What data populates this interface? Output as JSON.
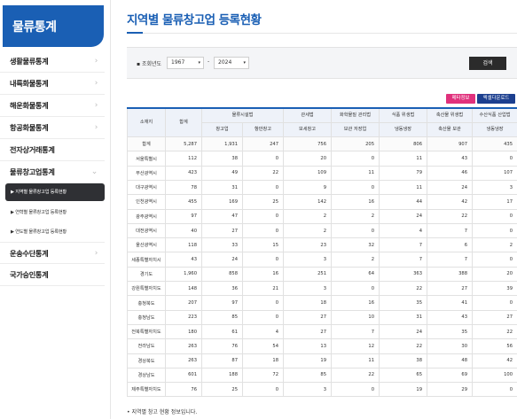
{
  "sidebar": {
    "title": "물류통계",
    "items": [
      {
        "label": "생활물류통계",
        "chev": "›"
      },
      {
        "label": "내륙화물통계",
        "chev": "›"
      },
      {
        "label": "해운화물통계",
        "chev": "›"
      },
      {
        "label": "항공화물통계",
        "chev": "›"
      },
      {
        "label": "전자상거래통계",
        "chev": ""
      },
      {
        "label": "물류창고업통계",
        "chev": "⌄"
      },
      {
        "label": "운송수단통계",
        "chev": "›"
      },
      {
        "label": "국가승인통계",
        "chev": ""
      }
    ],
    "subitems": [
      {
        "label": "▶ 지역별 물류창고업 등록현황"
      },
      {
        "label": "▶ 연혁별 물류창고업 등록현황"
      },
      {
        "label": "▶ 연도별 물류창고업 등록현황"
      }
    ]
  },
  "page": {
    "title": "지역별 물류창고업 등록현황"
  },
  "search": {
    "label": "▪ 조회년도",
    "from": "1967",
    "dash": "-",
    "to": "2024",
    "caret": "▾",
    "button": "검색"
  },
  "buttons": {
    "meta": "메타정보",
    "excel": "엑셀다운로드"
  },
  "table": {
    "headers": {
      "region": "소재지",
      "total": "합계",
      "logistics": "물류시설법",
      "logistics_general": "창고업",
      "logistics_port": "항만창고",
      "customs": "관세법",
      "customs_bonded": "보세창고",
      "chem": "화학물질 관리법",
      "chem_storage": "보관 저장업",
      "food": "식품 위생법",
      "food_cold": "냉동냉장",
      "livestock": "축산물 위생법",
      "livestock_storage": "축산물 보관",
      "fishery": "수산식품 산업법",
      "fishery_cold": "냉동냉장"
    },
    "rows": [
      {
        "region": "합계",
        "total": "5,287",
        "c1": "1,931",
        "c2": "247",
        "c3": "756",
        "c4": "205",
        "c5": "806",
        "c6": "907",
        "c7": "435"
      },
      {
        "region": "서울특별시",
        "total": "112",
        "c1": "38",
        "c2": "0",
        "c3": "20",
        "c4": "0",
        "c5": "11",
        "c6": "43",
        "c7": "0"
      },
      {
        "region": "부산광역시",
        "total": "423",
        "c1": "49",
        "c2": "22",
        "c3": "109",
        "c4": "11",
        "c5": "79",
        "c6": "46",
        "c7": "107"
      },
      {
        "region": "대구광역시",
        "total": "78",
        "c1": "31",
        "c2": "0",
        "c3": "9",
        "c4": "0",
        "c5": "11",
        "c6": "24",
        "c7": "3"
      },
      {
        "region": "인천광역시",
        "total": "455",
        "c1": "169",
        "c2": "25",
        "c3": "142",
        "c4": "16",
        "c5": "44",
        "c6": "42",
        "c7": "17"
      },
      {
        "region": "광주광역시",
        "total": "97",
        "c1": "47",
        "c2": "0",
        "c3": "2",
        "c4": "2",
        "c5": "24",
        "c6": "22",
        "c7": "0"
      },
      {
        "region": "대전광역시",
        "total": "40",
        "c1": "27",
        "c2": "0",
        "c3": "2",
        "c4": "0",
        "c5": "4",
        "c6": "7",
        "c7": "0"
      },
      {
        "region": "울산광역시",
        "total": "118",
        "c1": "33",
        "c2": "15",
        "c3": "23",
        "c4": "32",
        "c5": "7",
        "c6": "6",
        "c7": "2"
      },
      {
        "region": "세종특별자치시",
        "total": "43",
        "c1": "24",
        "c2": "0",
        "c3": "3",
        "c4": "2",
        "c5": "7",
        "c6": "7",
        "c7": "0"
      },
      {
        "region": "경기도",
        "total": "1,960",
        "c1": "858",
        "c2": "16",
        "c3": "251",
        "c4": "64",
        "c5": "363",
        "c6": "388",
        "c7": "20"
      },
      {
        "region": "강원특별자치도",
        "total": "148",
        "c1": "36",
        "c2": "21",
        "c3": "3",
        "c4": "0",
        "c5": "22",
        "c6": "27",
        "c7": "39"
      },
      {
        "region": "충청북도",
        "total": "207",
        "c1": "97",
        "c2": "0",
        "c3": "18",
        "c4": "16",
        "c5": "35",
        "c6": "41",
        "c7": "0"
      },
      {
        "region": "충청남도",
        "total": "223",
        "c1": "85",
        "c2": "0",
        "c3": "27",
        "c4": "10",
        "c5": "31",
        "c6": "43",
        "c7": "27"
      },
      {
        "region": "전북특별자치도",
        "total": "180",
        "c1": "61",
        "c2": "4",
        "c3": "27",
        "c4": "7",
        "c5": "24",
        "c6": "35",
        "c7": "22"
      },
      {
        "region": "전라남도",
        "total": "263",
        "c1": "76",
        "c2": "54",
        "c3": "13",
        "c4": "12",
        "c5": "22",
        "c6": "30",
        "c7": "56"
      },
      {
        "region": "경상북도",
        "total": "263",
        "c1": "87",
        "c2": "18",
        "c3": "19",
        "c4": "11",
        "c5": "38",
        "c6": "48",
        "c7": "42"
      },
      {
        "region": "경상남도",
        "total": "601",
        "c1": "188",
        "c2": "72",
        "c3": "85",
        "c4": "22",
        "c5": "65",
        "c6": "69",
        "c7": "100"
      },
      {
        "region": "제주특별자치도",
        "total": "76",
        "c1": "25",
        "c2": "0",
        "c3": "3",
        "c4": "0",
        "c5": "19",
        "c6": "29",
        "c7": "0"
      }
    ]
  },
  "footnote": "• 지역별 창고 현황 정보입니다."
}
